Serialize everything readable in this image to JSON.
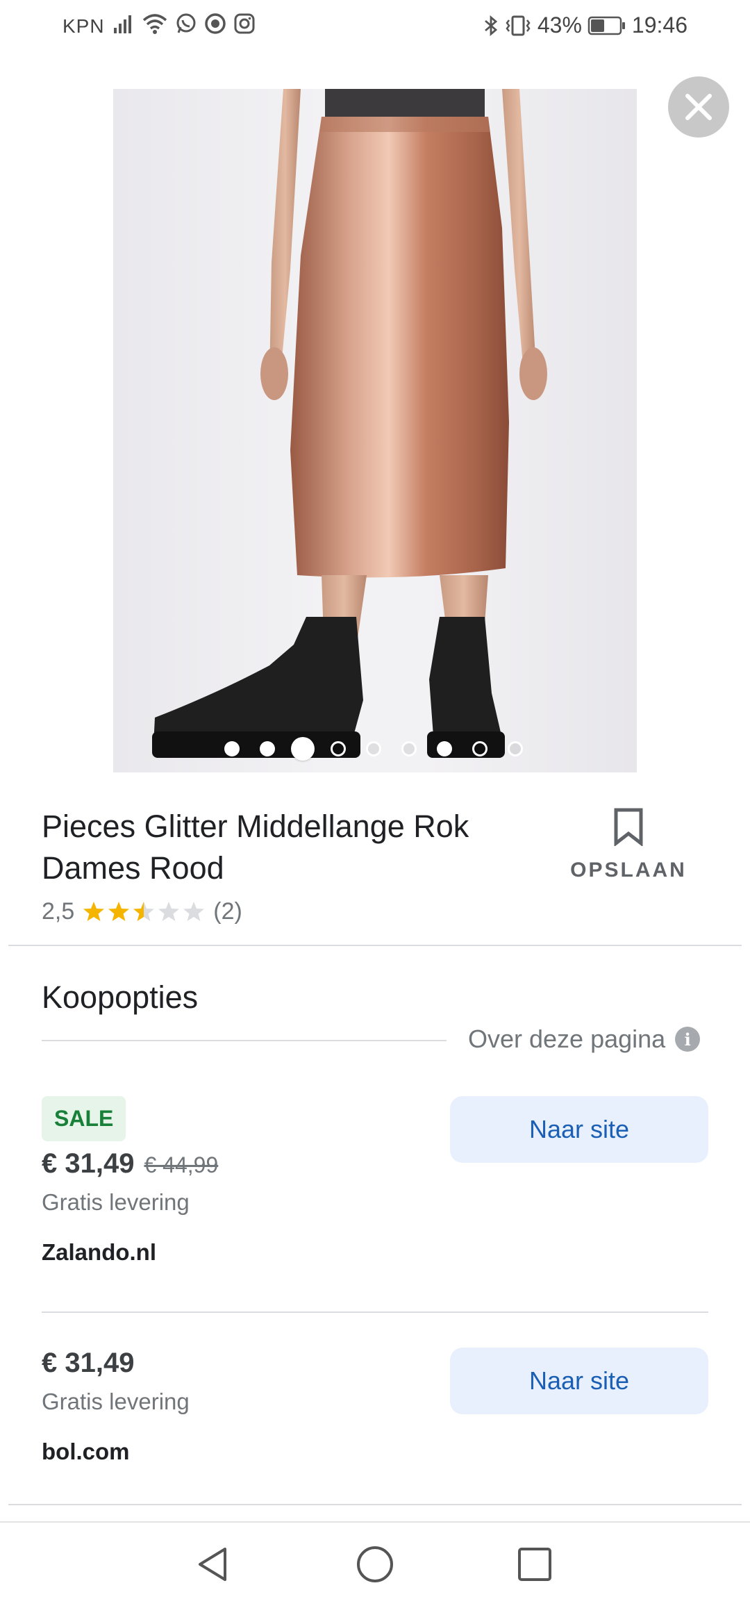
{
  "status_bar": {
    "carrier": "KPN",
    "battery": "43%",
    "time": "19:46",
    "icons": [
      "signal-icon",
      "wifi-icon",
      "whatsapp-icon",
      "sync-icon",
      "instagram-icon",
      "bluetooth-icon",
      "vibrate-icon",
      "battery-icon"
    ]
  },
  "product": {
    "title": "Pieces Glitter Middellange Rok Dames Rood",
    "image_description_icon": "product-photo",
    "carousel": {
      "total": 9,
      "active_index": 2
    },
    "rating": {
      "value_text": "2,5",
      "stars": 2.5,
      "max": 5,
      "count_text": "(2)"
    },
    "save_label": "OPSLAAN"
  },
  "section": {
    "heading": "Koopopties",
    "about_link": "Over deze pagina",
    "info_icon": "i"
  },
  "offers": [
    {
      "badge": "SALE",
      "price": "€ 31,49",
      "old_price": "€ 44,99",
      "delivery": "Gratis levering",
      "seller": "Zalando.nl",
      "button": "Naar site"
    },
    {
      "price": "€ 31,49",
      "delivery": "Gratis levering",
      "seller": "bol.com",
      "button": "Naar site"
    }
  ],
  "colors": {
    "sale_bg": "#e6f4ea",
    "sale_text": "#188038",
    "button_bg": "#e8f0fe",
    "button_text": "#1a5fb4",
    "star": "#f4b400"
  }
}
